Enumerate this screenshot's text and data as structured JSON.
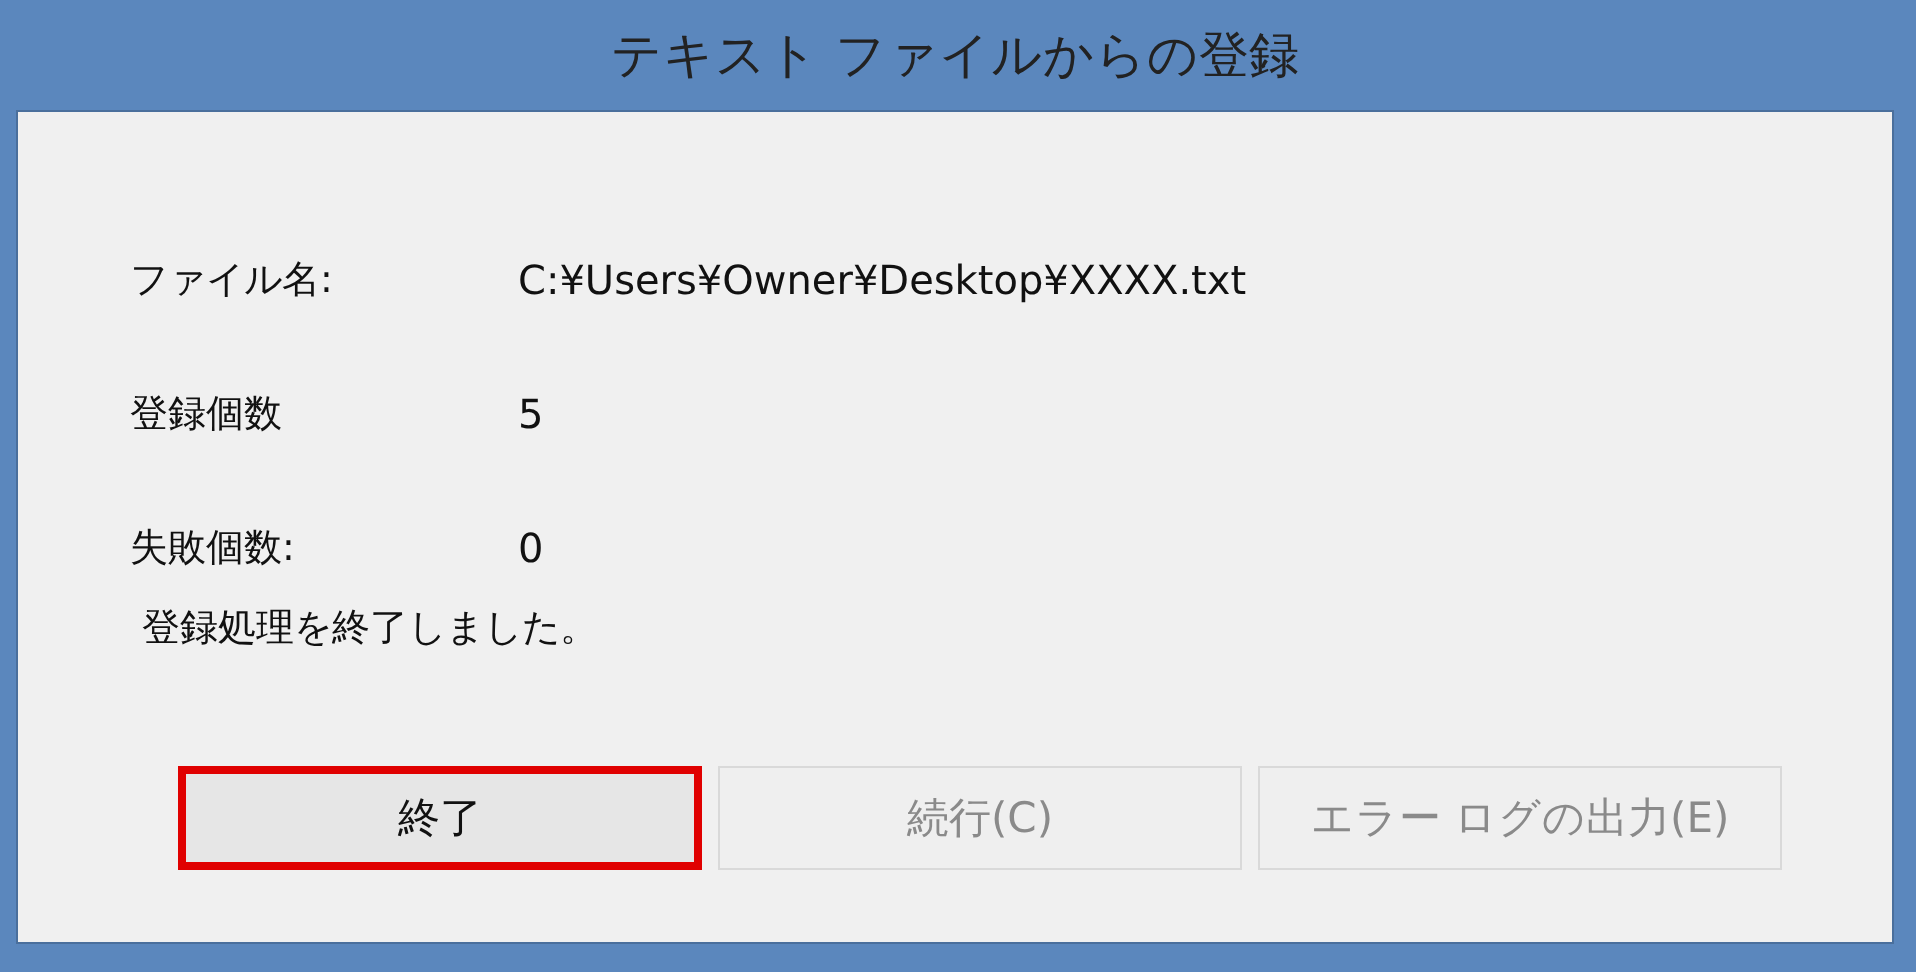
{
  "window": {
    "title": "テキスト ファイルからの登録"
  },
  "fields": [
    {
      "label": "ファイル名:",
      "value": "C:¥Users¥Owner¥Desktop¥XXXX.txt"
    },
    {
      "label": "登録個数",
      "value": "5"
    },
    {
      "label": "失敗個数:",
      "value": "0"
    }
  ],
  "message": "登録処理を終了しました。",
  "buttons": [
    {
      "label": "終了",
      "disabled": false,
      "highlighted": true
    },
    {
      "label": "続行(C)",
      "disabled": true,
      "highlighted": false
    },
    {
      "label": "エラー ログの出力(E)",
      "disabled": true,
      "highlighted": false
    }
  ]
}
